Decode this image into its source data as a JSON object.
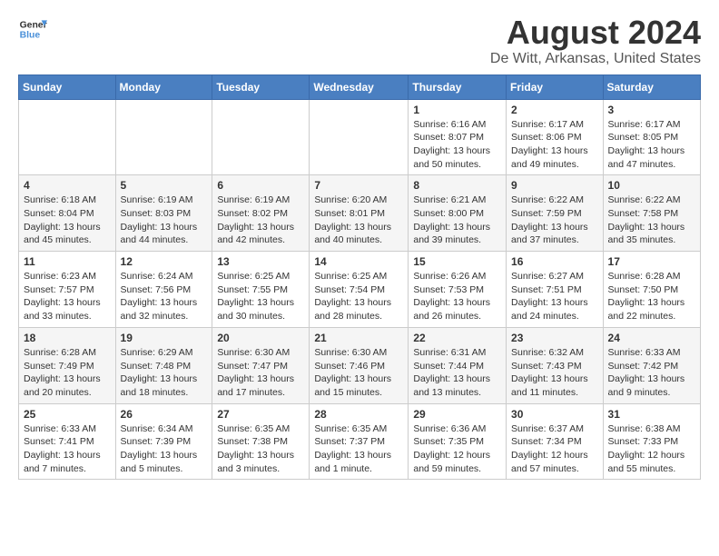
{
  "logo": {
    "line1": "General",
    "line2": "Blue"
  },
  "title": "August 2024",
  "location": "De Witt, Arkansas, United States",
  "weekdays": [
    "Sunday",
    "Monday",
    "Tuesday",
    "Wednesday",
    "Thursday",
    "Friday",
    "Saturday"
  ],
  "weeks": [
    [
      {
        "day": "",
        "sunrise": "",
        "sunset": "",
        "daylight": ""
      },
      {
        "day": "",
        "sunrise": "",
        "sunset": "",
        "daylight": ""
      },
      {
        "day": "",
        "sunrise": "",
        "sunset": "",
        "daylight": ""
      },
      {
        "day": "",
        "sunrise": "",
        "sunset": "",
        "daylight": ""
      },
      {
        "day": "1",
        "sunrise": "Sunrise: 6:16 AM",
        "sunset": "Sunset: 8:07 PM",
        "daylight": "Daylight: 13 hours and 50 minutes."
      },
      {
        "day": "2",
        "sunrise": "Sunrise: 6:17 AM",
        "sunset": "Sunset: 8:06 PM",
        "daylight": "Daylight: 13 hours and 49 minutes."
      },
      {
        "day": "3",
        "sunrise": "Sunrise: 6:17 AM",
        "sunset": "Sunset: 8:05 PM",
        "daylight": "Daylight: 13 hours and 47 minutes."
      }
    ],
    [
      {
        "day": "4",
        "sunrise": "Sunrise: 6:18 AM",
        "sunset": "Sunset: 8:04 PM",
        "daylight": "Daylight: 13 hours and 45 minutes."
      },
      {
        "day": "5",
        "sunrise": "Sunrise: 6:19 AM",
        "sunset": "Sunset: 8:03 PM",
        "daylight": "Daylight: 13 hours and 44 minutes."
      },
      {
        "day": "6",
        "sunrise": "Sunrise: 6:19 AM",
        "sunset": "Sunset: 8:02 PM",
        "daylight": "Daylight: 13 hours and 42 minutes."
      },
      {
        "day": "7",
        "sunrise": "Sunrise: 6:20 AM",
        "sunset": "Sunset: 8:01 PM",
        "daylight": "Daylight: 13 hours and 40 minutes."
      },
      {
        "day": "8",
        "sunrise": "Sunrise: 6:21 AM",
        "sunset": "Sunset: 8:00 PM",
        "daylight": "Daylight: 13 hours and 39 minutes."
      },
      {
        "day": "9",
        "sunrise": "Sunrise: 6:22 AM",
        "sunset": "Sunset: 7:59 PM",
        "daylight": "Daylight: 13 hours and 37 minutes."
      },
      {
        "day": "10",
        "sunrise": "Sunrise: 6:22 AM",
        "sunset": "Sunset: 7:58 PM",
        "daylight": "Daylight: 13 hours and 35 minutes."
      }
    ],
    [
      {
        "day": "11",
        "sunrise": "Sunrise: 6:23 AM",
        "sunset": "Sunset: 7:57 PM",
        "daylight": "Daylight: 13 hours and 33 minutes."
      },
      {
        "day": "12",
        "sunrise": "Sunrise: 6:24 AM",
        "sunset": "Sunset: 7:56 PM",
        "daylight": "Daylight: 13 hours and 32 minutes."
      },
      {
        "day": "13",
        "sunrise": "Sunrise: 6:25 AM",
        "sunset": "Sunset: 7:55 PM",
        "daylight": "Daylight: 13 hours and 30 minutes."
      },
      {
        "day": "14",
        "sunrise": "Sunrise: 6:25 AM",
        "sunset": "Sunset: 7:54 PM",
        "daylight": "Daylight: 13 hours and 28 minutes."
      },
      {
        "day": "15",
        "sunrise": "Sunrise: 6:26 AM",
        "sunset": "Sunset: 7:53 PM",
        "daylight": "Daylight: 13 hours and 26 minutes."
      },
      {
        "day": "16",
        "sunrise": "Sunrise: 6:27 AM",
        "sunset": "Sunset: 7:51 PM",
        "daylight": "Daylight: 13 hours and 24 minutes."
      },
      {
        "day": "17",
        "sunrise": "Sunrise: 6:28 AM",
        "sunset": "Sunset: 7:50 PM",
        "daylight": "Daylight: 13 hours and 22 minutes."
      }
    ],
    [
      {
        "day": "18",
        "sunrise": "Sunrise: 6:28 AM",
        "sunset": "Sunset: 7:49 PM",
        "daylight": "Daylight: 13 hours and 20 minutes."
      },
      {
        "day": "19",
        "sunrise": "Sunrise: 6:29 AM",
        "sunset": "Sunset: 7:48 PM",
        "daylight": "Daylight: 13 hours and 18 minutes."
      },
      {
        "day": "20",
        "sunrise": "Sunrise: 6:30 AM",
        "sunset": "Sunset: 7:47 PM",
        "daylight": "Daylight: 13 hours and 17 minutes."
      },
      {
        "day": "21",
        "sunrise": "Sunrise: 6:30 AM",
        "sunset": "Sunset: 7:46 PM",
        "daylight": "Daylight: 13 hours and 15 minutes."
      },
      {
        "day": "22",
        "sunrise": "Sunrise: 6:31 AM",
        "sunset": "Sunset: 7:44 PM",
        "daylight": "Daylight: 13 hours and 13 minutes."
      },
      {
        "day": "23",
        "sunrise": "Sunrise: 6:32 AM",
        "sunset": "Sunset: 7:43 PM",
        "daylight": "Daylight: 13 hours and 11 minutes."
      },
      {
        "day": "24",
        "sunrise": "Sunrise: 6:33 AM",
        "sunset": "Sunset: 7:42 PM",
        "daylight": "Daylight: 13 hours and 9 minutes."
      }
    ],
    [
      {
        "day": "25",
        "sunrise": "Sunrise: 6:33 AM",
        "sunset": "Sunset: 7:41 PM",
        "daylight": "Daylight: 13 hours and 7 minutes."
      },
      {
        "day": "26",
        "sunrise": "Sunrise: 6:34 AM",
        "sunset": "Sunset: 7:39 PM",
        "daylight": "Daylight: 13 hours and 5 minutes."
      },
      {
        "day": "27",
        "sunrise": "Sunrise: 6:35 AM",
        "sunset": "Sunset: 7:38 PM",
        "daylight": "Daylight: 13 hours and 3 minutes."
      },
      {
        "day": "28",
        "sunrise": "Sunrise: 6:35 AM",
        "sunset": "Sunset: 7:37 PM",
        "daylight": "Daylight: 13 hours and 1 minute."
      },
      {
        "day": "29",
        "sunrise": "Sunrise: 6:36 AM",
        "sunset": "Sunset: 7:35 PM",
        "daylight": "Daylight: 12 hours and 59 minutes."
      },
      {
        "day": "30",
        "sunrise": "Sunrise: 6:37 AM",
        "sunset": "Sunset: 7:34 PM",
        "daylight": "Daylight: 12 hours and 57 minutes."
      },
      {
        "day": "31",
        "sunrise": "Sunrise: 6:38 AM",
        "sunset": "Sunset: 7:33 PM",
        "daylight": "Daylight: 12 hours and 55 minutes."
      }
    ]
  ]
}
